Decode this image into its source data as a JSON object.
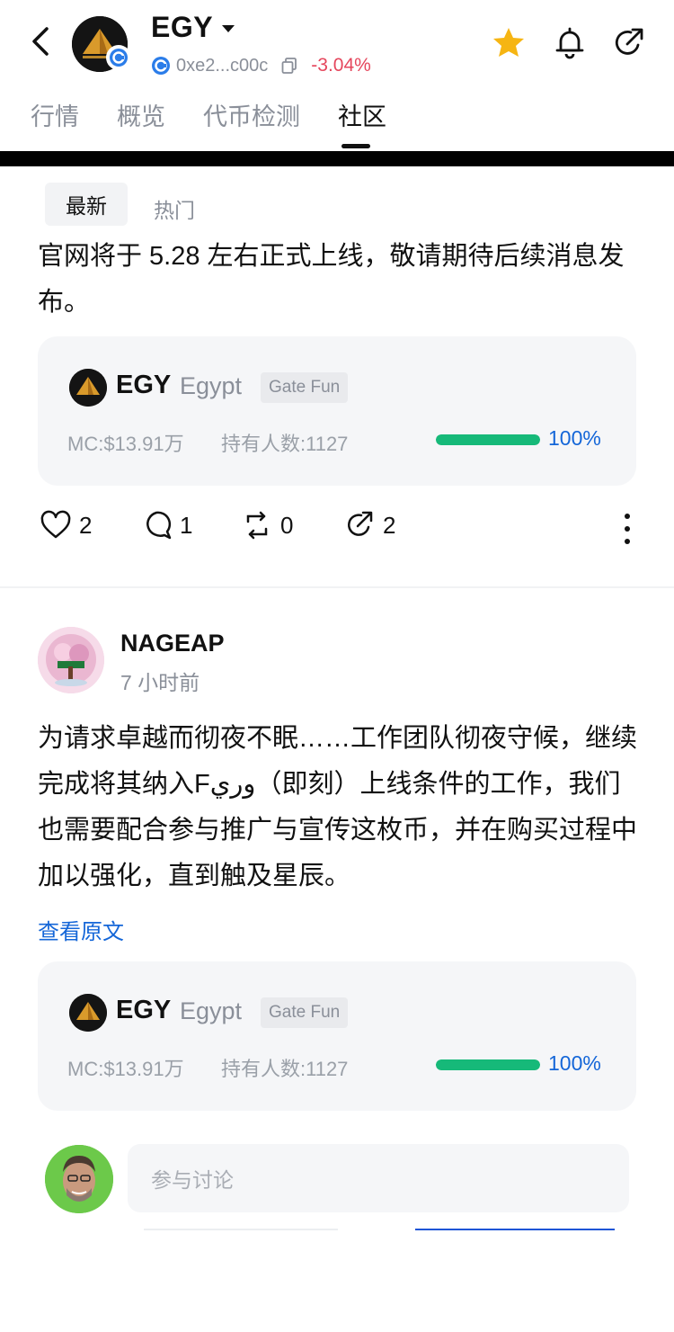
{
  "header": {
    "title": "EGY",
    "address": "0xe2...c00c",
    "change": "-3.04%",
    "colors": {
      "change": "#e5475d",
      "star": "#f6b513",
      "accent": "#1466d8"
    }
  },
  "tabs": [
    {
      "label": "行情"
    },
    {
      "label": "概览"
    },
    {
      "label": "代币检测"
    },
    {
      "label": "社区"
    }
  ],
  "active_tab": "社区",
  "sort": {
    "latest": "最新",
    "hot": "热门"
  },
  "post1": {
    "text": "官网将于 5.28 左右正式上线，敬请期待后续消息发布。",
    "card": {
      "symbol": "EGY",
      "name": "Egypt",
      "tag": "Gate Fun",
      "mc": "MC:$13.91万",
      "holders": "持有人数:1127",
      "progress_pct": 100,
      "progress_label": "100%"
    },
    "actions": {
      "likes": "2",
      "comments": "1",
      "reposts": "0",
      "shares": "2"
    }
  },
  "post2": {
    "username": "NAGEAP",
    "time": "7 小时前",
    "text": "为请求卓越而彻夜不眠……工作团队彻夜守候，继续完成将其纳入Fوري（即刻）上线条件的工作，我们也需要配合参与推广与宣传这枚币，并在购买过程中加以强化，直到触及星辰。",
    "view_original": "查看原文",
    "card": {
      "symbol": "EGY",
      "name": "Egypt",
      "tag": "Gate Fun",
      "mc": "MC:$13.91万",
      "holders": "持有人数:1127",
      "progress_pct": 100,
      "progress_label": "100%"
    }
  },
  "comment": {
    "placeholder": "参与讨论"
  },
  "icons": [
    "back-arrow-icon",
    "chain-icon",
    "copy-icon",
    "star-icon",
    "bell-icon",
    "share-icon",
    "heart-icon",
    "comment-icon",
    "repost-icon",
    "more-icon"
  ]
}
